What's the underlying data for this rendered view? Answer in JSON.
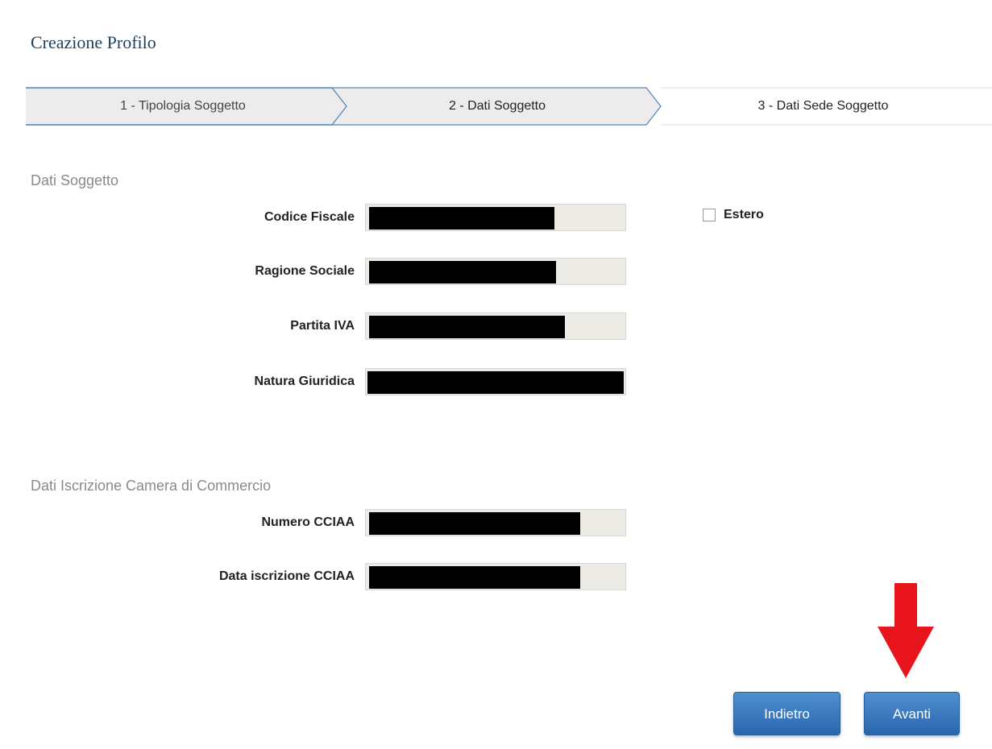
{
  "page": {
    "title": "Creazione Profilo"
  },
  "stepper": {
    "steps": [
      {
        "label": "1 - Tipologia Soggetto",
        "state": "completed"
      },
      {
        "label": "2 - Dati Soggetto",
        "state": "current"
      },
      {
        "label": "3 - Dati Sede Soggetto",
        "state": "upcoming"
      }
    ]
  },
  "dati_soggetto": {
    "title": "Dati Soggetto",
    "fields": [
      {
        "label": "Codice Fiscale",
        "value": "[redacted]"
      },
      {
        "label": "Ragione Sociale",
        "value": "[redacted]"
      },
      {
        "label": "Partita IVA",
        "value": "[redacted]"
      },
      {
        "label": "Natura Giuridica",
        "value": "[redacted]"
      }
    ],
    "estero": {
      "label": "Estero",
      "checked": false
    }
  },
  "dati_cciaa": {
    "title": "Dati Iscrizione Camera di Commercio",
    "fields": [
      {
        "label": "Numero CCIAA",
        "value": "[redacted]"
      },
      {
        "label": "Data iscrizione CCIAA",
        "value": "[redacted]"
      }
    ]
  },
  "buttons": {
    "back": "Indietro",
    "next": "Avanti"
  },
  "colors": {
    "accent_button": "#2a66ad",
    "title": "#1d3f5e",
    "annotation_arrow": "#e8141b"
  },
  "icons": {
    "annotation": "arrow-down-icon"
  }
}
